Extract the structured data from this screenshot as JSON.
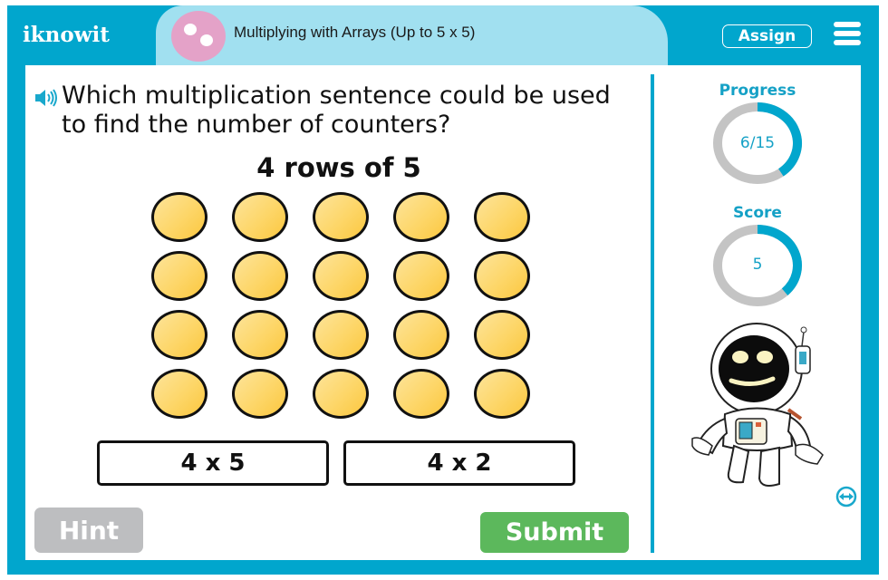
{
  "header": {
    "logo_text": "iknowit",
    "lesson_title": "Multiplying with Arrays (Up to 5 x 5)",
    "assign_label": "Assign",
    "menu_icon": "hamburger-menu-icon",
    "topic_icon": "counters-icon"
  },
  "question": {
    "audio_icon": "speaker-icon",
    "text": "Which multiplication sentence could be used to find the number of counters?",
    "prompt": "4 rows of 5",
    "array": {
      "rows": 4,
      "columns": 5,
      "counter_color": "#fdd668"
    }
  },
  "answers": [
    {
      "label": "4 x 5"
    },
    {
      "label": "4 x 2"
    }
  ],
  "buttons": {
    "hint_label": "Hint",
    "submit_label": "Submit"
  },
  "sidebar": {
    "progress": {
      "label": "Progress",
      "text": "6/15",
      "current": 6,
      "total": 15
    },
    "score": {
      "label": "Score",
      "text": "5",
      "fraction": 0.38
    },
    "mascot": "astronaut-mascot",
    "swap_icon": "swap-arrows-icon"
  },
  "colors": {
    "brand": "#01a6cd",
    "title_bg": "#a1e0f0",
    "ring_track": "#c4c4c4",
    "ring_fill": "#01a6cd",
    "submit": "#5cb85c",
    "hint": "#bdbec0"
  }
}
